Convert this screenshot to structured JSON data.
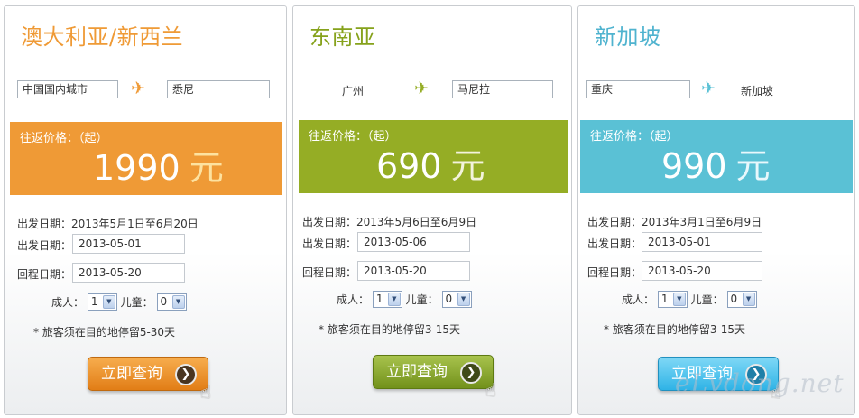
{
  "colors": {
    "orange": "#ef9a36",
    "green": "#95ad25",
    "blue": "#5ac1d5",
    "title_orange": "#ef9a36",
    "title_green": "#86a21c",
    "title_blue": "#4fb3cf"
  },
  "icons": {
    "plane": "airplane-icon",
    "arrow": "arrow-right-circle-icon",
    "cursor": "hand-cursor-icon"
  },
  "cards": [
    {
      "title": "澳大利亚/新西兰",
      "origin": "中国国内城市",
      "destination": "悉尼",
      "price_label": "往返价格：（起）",
      "price": "1990",
      "unit": "元",
      "departure_range": "出发日期：2013年5月1日至6月20日",
      "depart_label": "出发日期：",
      "depart_value": "2013-05-01",
      "return_label": "回程日期：",
      "return_value": "2013-05-20",
      "adults_label": "成人：",
      "adults_value": "1",
      "children_label": "儿童：",
      "children_value": "0",
      "stay_note": "* 旅客须在目的地停留5-30天",
      "button_label": "立即查询"
    },
    {
      "title": "东南亚",
      "origin": "广州",
      "destination": "马尼拉",
      "price_label": "往返价格：（起）",
      "price": "690",
      "unit": "元",
      "departure_range": "出发日期：2013年5月6日至6月9日",
      "depart_label": "出发日期：",
      "depart_value": "2013-05-06",
      "return_label": "回程日期：",
      "return_value": "2013-05-20",
      "adults_label": "成人：",
      "adults_value": "1",
      "children_label": "儿童：",
      "children_value": "0",
      "stay_note": "* 旅客须在目的地停留3-15天",
      "button_label": "立即查询"
    },
    {
      "title": "新加坡",
      "origin": "重庆",
      "destination": "新加坡",
      "price_label": "往返价格：（起）",
      "price": "990",
      "unit": "元",
      "departure_range": "出发日期：2013年3月1日至6月9日",
      "depart_label": "出发日期：",
      "depart_value": "2013-05-01",
      "return_label": "回程日期：",
      "return_value": "2013-05-20",
      "adults_label": "成人：",
      "adults_value": "1",
      "children_label": "儿童：",
      "children_value": "0",
      "stay_note": "* 旅客须在目的地停留3-15天",
      "button_label": "立即查询"
    }
  ],
  "watermark": "eLvdong.net"
}
